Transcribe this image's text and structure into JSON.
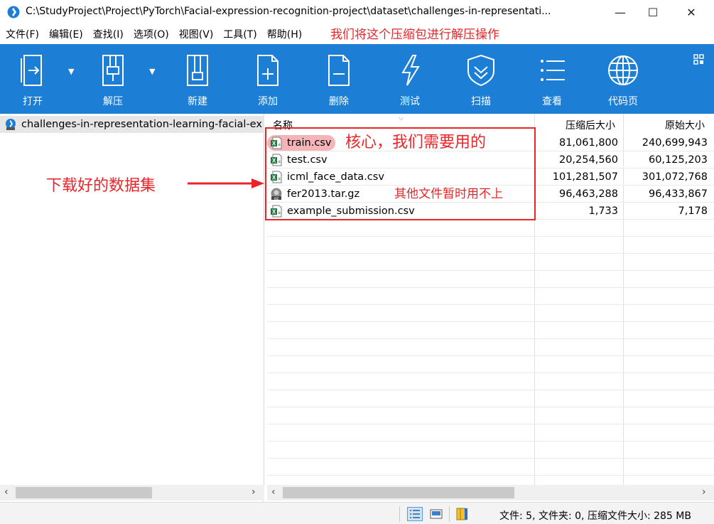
{
  "window": {
    "title": "C:\\StudyProject\\Project\\PyTorch\\Facial-expression-recognition-project\\dataset\\challenges-in-representati...",
    "controls": {
      "minimize": "—",
      "maximize": "☐",
      "close": "✕"
    }
  },
  "menu": {
    "items": [
      "文件(F)",
      "编辑(E)",
      "查找(I)",
      "选项(O)",
      "视图(V)",
      "工具(T)",
      "帮助(H)"
    ],
    "annotation": "我们将这个压缩包进行解压操作"
  },
  "toolbar": {
    "buttons": [
      {
        "label": "打开",
        "icon": "open-icon"
      },
      {
        "label": "解压",
        "icon": "extract-icon"
      },
      {
        "label": "新建",
        "icon": "new-archive-icon"
      },
      {
        "label": "添加",
        "icon": "add-icon"
      },
      {
        "label": "删除",
        "icon": "delete-icon"
      },
      {
        "label": "测试",
        "icon": "test-icon"
      },
      {
        "label": "扫描",
        "icon": "scan-icon"
      },
      {
        "label": "查看",
        "icon": "view-icon"
      },
      {
        "label": "代码页",
        "icon": "codepage-icon"
      }
    ],
    "accent": "#1d7ed6"
  },
  "tree": {
    "root_label": "challenges-in-representation-learning-facial-ex"
  },
  "file_list": {
    "columns": {
      "name": "名称",
      "compressed": "压缩后大小",
      "original": "原始大小"
    },
    "files": [
      {
        "name": "train.csv",
        "compressed": "81,061,800",
        "original": "240,699,943",
        "icon": "excel-icon"
      },
      {
        "name": "test.csv",
        "compressed": "20,254,560",
        "original": "60,125,203",
        "icon": "excel-icon"
      },
      {
        "name": "icml_face_data.csv",
        "compressed": "101,281,507",
        "original": "301,072,768",
        "icon": "excel-icon"
      },
      {
        "name": "fer2013.tar.gz",
        "compressed": "96,463,288",
        "original": "96,433,867",
        "icon": "gz-icon"
      },
      {
        "name": "example_submission.csv",
        "compressed": "1,733",
        "original": "7,178",
        "icon": "excel-icon"
      }
    ]
  },
  "annotations": {
    "core": "核心，我们需要用的",
    "other": "其他文件暂时用不上",
    "dataset": "下载好的数据集",
    "color": "#e8262a"
  },
  "status": {
    "text": "文件: 5, 文件夹: 0, 压缩文件大小: 285 MB"
  }
}
